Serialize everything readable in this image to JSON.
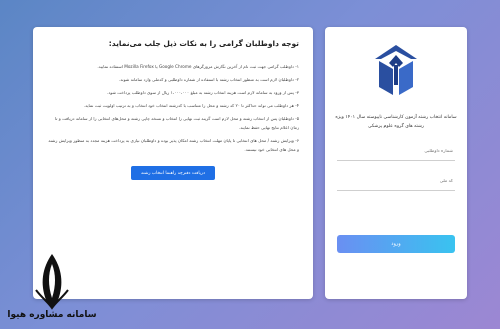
{
  "notice": {
    "title": "توجه داوطلبان گرامی را به نکات ذیل جلب می‌نماید:",
    "items": [
      "۱- داوطلب گرامی جهت ثبت نام از آخرین نگارش مرورگرهای Google Chrome یا Mozilla Firefox استفاده نمایید.",
      "۲- داوطلبان لازم است به منظور انتخاب رشته با استفاده از شماره داوطلبی و کدملی وارد سامانه شوند.",
      "۳- پس از ورود به سامانه لازم است هزینه انتخاب رشته به مبلغ ۱،۰۰۰،۰۰۰ ریال از سوی داوطلب پرداخت شود.",
      "۴- هر داوطلب می تواند حداکثر تا ۲۰ کد رشته و محل را متناسب با کدرشته انتخاب خود انتخاب و به ترتیب اولویت ثبت نماید.",
      "۵- داوطلبان پس از انتخاب رشته و محل لازم است گزینه ثبت نهایی را انتخاب و نسخه چاپی رشته و محل‌های انتخابی را از سامانه دریافت و تا زمان اعلام نتایج نهایی حفظ نمایند.",
      "۶- ویرایش رشته / محل های انتخابی تا پایان مهلت انتخاب رشته امکان پذیر بوده و داوطلبان نیازی به پرداخت هزینه مجدد به منظور ویرایش رشته و محل های انتخابی خود نیستند."
    ],
    "guide_button": "دریافت دفترچه راهنما انتخاب رشته"
  },
  "login": {
    "logo_icon": "azad-university-logo",
    "description": "سامانه انتخاب رشته آزمون کارشناسی ناپیوسته سال ۱۴۰۱ ویژه رشته های گروه علوم پزشکی",
    "candidate_placeholder": "شماره داوطلبی",
    "national_code_placeholder": "کد ملی",
    "submit_label": "ورود"
  },
  "watermark": {
    "text": "سامانه مشاوره هیوا",
    "icon": "quill-icon"
  },
  "colors": {
    "background_start": "#5b86c5",
    "background_end": "#9c87d3",
    "guide_button": "#1f6fe5",
    "submit_gradient_start": "#6a8ff2",
    "submit_gradient_end": "#39c3f0",
    "logo_blue": "#2a4fa0"
  }
}
